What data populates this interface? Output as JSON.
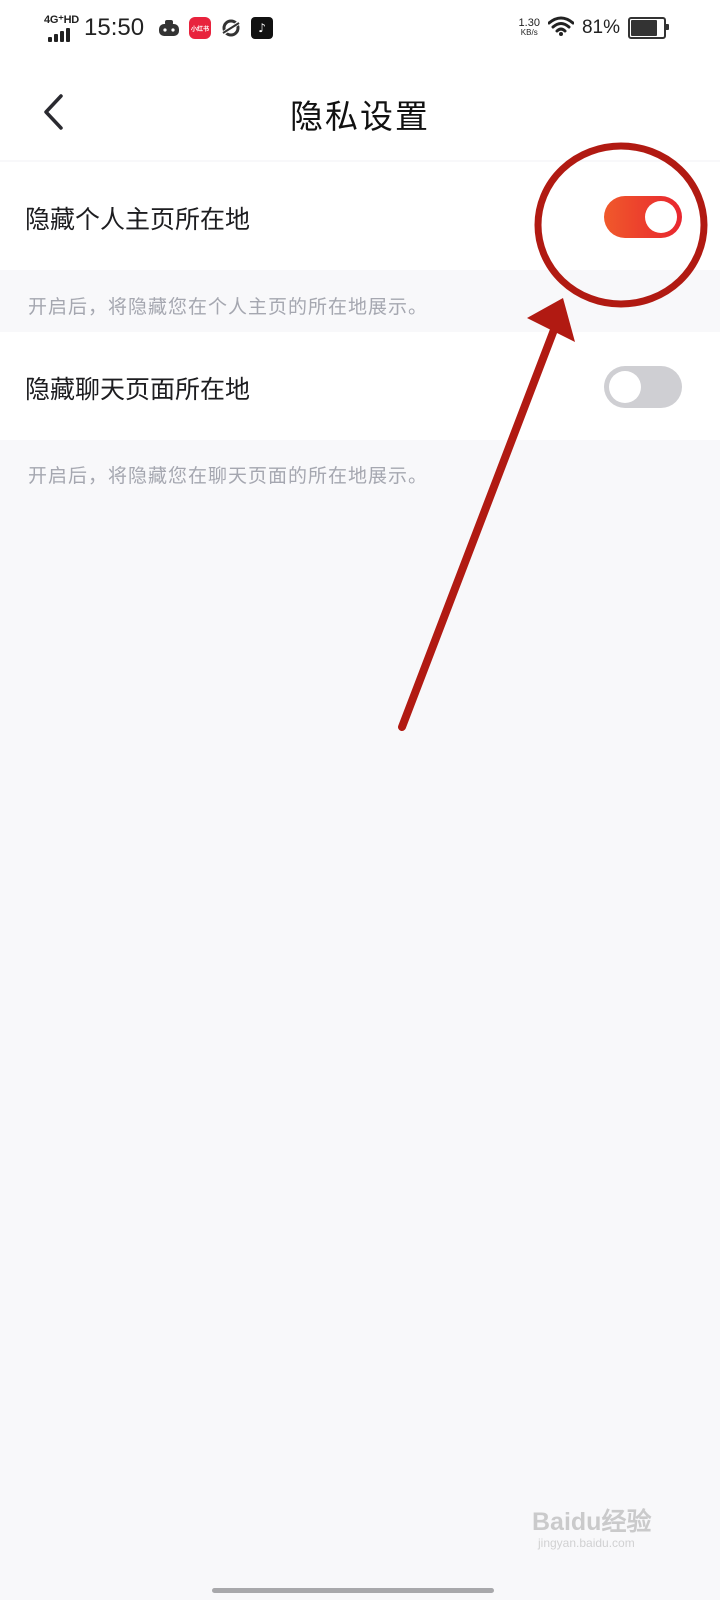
{
  "status_bar": {
    "network_type": "4G⁺HD",
    "time": "15:50",
    "net_speed_value": "1.30",
    "net_speed_unit": "KB/s",
    "battery_percent": "81%",
    "battery_level": 0.81,
    "notification_icons": [
      "game-controller-icon",
      "xiaohongshu-app-icon",
      "browser-app-icon",
      "tiktok-app-icon"
    ]
  },
  "header": {
    "title": "隐私设置"
  },
  "settings": [
    {
      "label": "隐藏个人主页所在地",
      "enabled": true,
      "description": "开启后，将隐藏您在个人主页的所在地展示。"
    },
    {
      "label": "隐藏聊天页面所在地",
      "enabled": false,
      "description": "开启后，将隐藏您在聊天页面的所在地展示。"
    }
  ],
  "watermark": {
    "brand": "Baidu经验",
    "sub": "jingyan.baidu.com"
  },
  "colors": {
    "toggle_on_start": "#f0592b",
    "toggle_on_end": "#e8262f",
    "toggle_off": "#cfcfd3",
    "annotation_red": "#b11a12",
    "description_text": "#a5a7b0",
    "page_background": "#f8f8fa"
  }
}
